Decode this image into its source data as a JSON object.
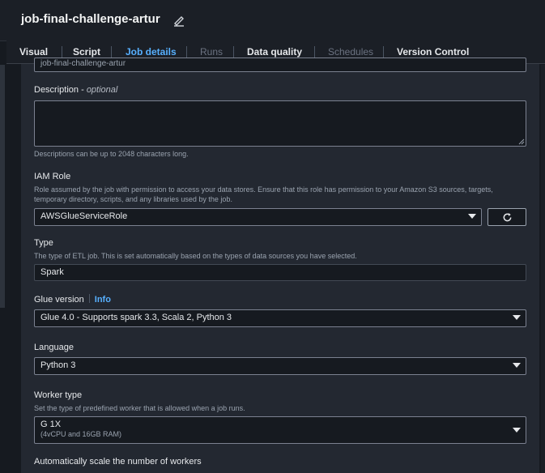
{
  "header": {
    "title": "job-final-challenge-artur"
  },
  "tabs": [
    {
      "label": "Visual"
    },
    {
      "label": "Script"
    },
    {
      "label": "Job details"
    },
    {
      "label": "Runs"
    },
    {
      "label": "Data quality"
    },
    {
      "label": "Schedules"
    },
    {
      "label": "Version Control"
    }
  ],
  "form": {
    "name_value": "job-final-challenge-artur",
    "description": {
      "label": "Description",
      "optional": "optional",
      "value": "",
      "hint": "Descriptions can be up to 2048 characters long."
    },
    "iam_role": {
      "label": "IAM Role",
      "hint": "Role assumed by the job with permission to access your data stores. Ensure that this role has permission to your Amazon S3 sources, targets, temporary directory, scripts, and any libraries used by the job.",
      "value": "AWSGlueServiceRole"
    },
    "type": {
      "label": "Type",
      "hint": "The type of ETL job. This is set automatically based on the types of data sources you have selected.",
      "value": "Spark"
    },
    "glue_version": {
      "label": "Glue version",
      "info": "Info",
      "value": "Glue 4.0 - Supports spark 3.3, Scala 2, Python 3"
    },
    "language": {
      "label": "Language",
      "value": "Python 3"
    },
    "worker_type": {
      "label": "Worker type",
      "hint": "Set the type of predefined worker that is allowed when a job runs.",
      "value": "G 1X",
      "sub": "(4vCPU and 16GB RAM)"
    },
    "autoscale": {
      "label": "Automatically scale the number of workers"
    }
  }
}
